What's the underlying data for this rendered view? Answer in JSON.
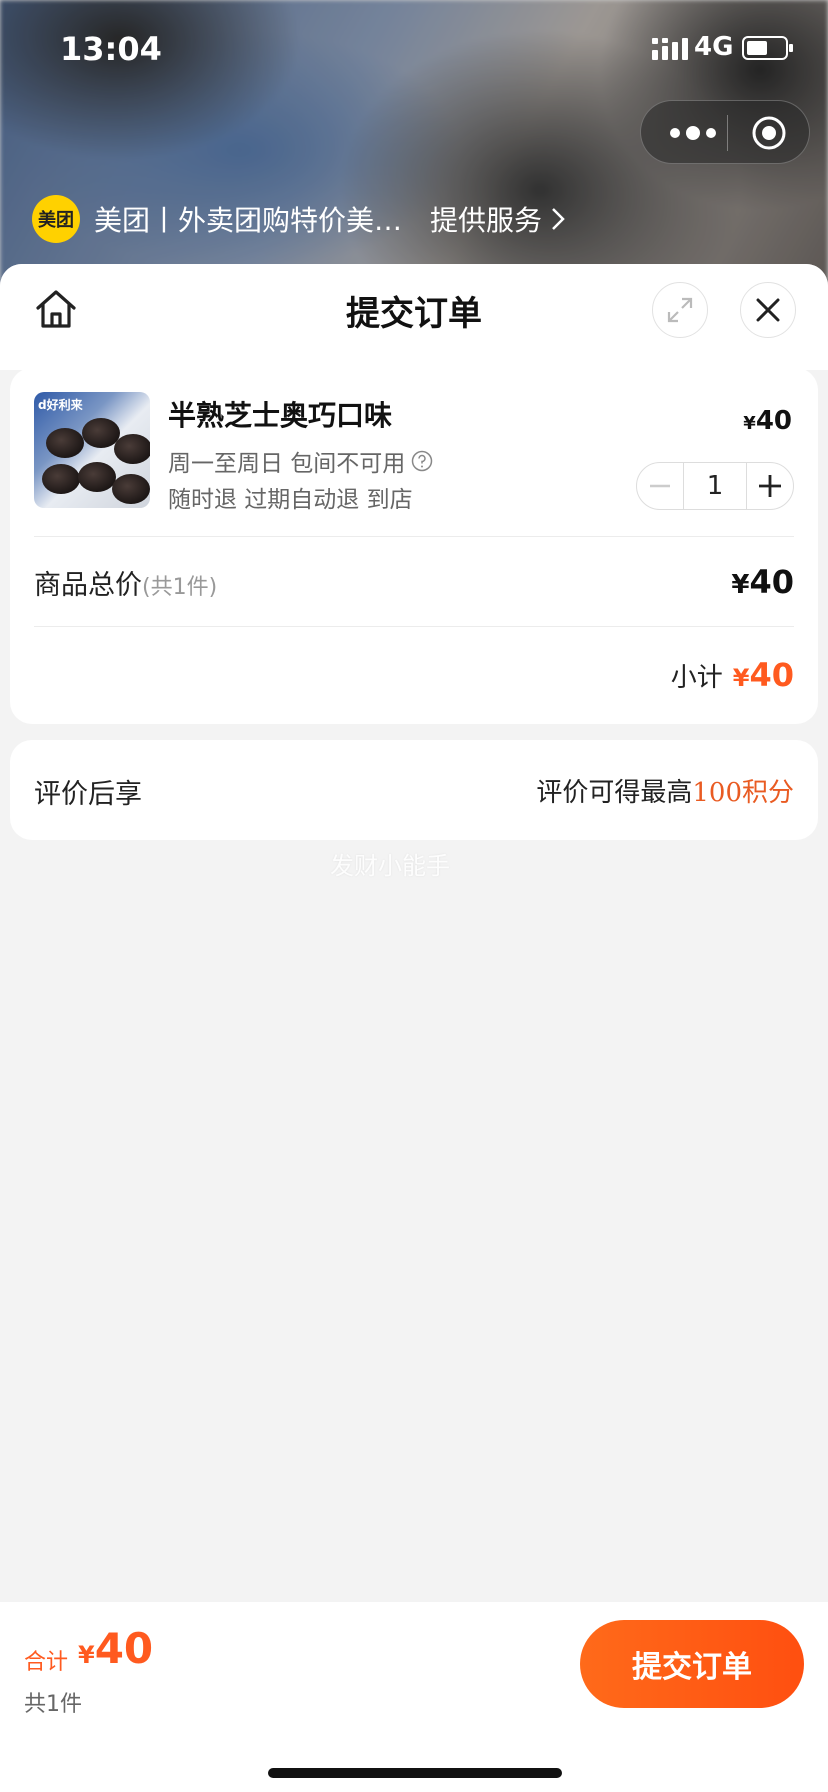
{
  "status_bar": {
    "time": "13:04",
    "network": "4G",
    "battery_level": 0.55
  },
  "service": {
    "logo_text": "美团",
    "name": "美团丨外卖团购特价美…",
    "provide_label": "提供服务"
  },
  "header": {
    "title": "提交订单"
  },
  "product": {
    "name": "半熟芝士奥巧口味",
    "price_symbol": "¥",
    "price": "40",
    "meta1": "周一至周日 包间不可用",
    "meta2": "随时退 过期自动退 到店",
    "thumb_brand": "d好利来",
    "quantity": "1"
  },
  "totals": {
    "label": "商品总价",
    "count": "(共1件)",
    "symbol": "¥",
    "value": "40",
    "subtotal_label": "小计",
    "subtotal_symbol": "¥",
    "subtotal_value": "40"
  },
  "review": {
    "label": "评价后享",
    "desc": "评价可得最高",
    "points": "100积分"
  },
  "watermark": "发财小能手",
  "footer": {
    "sum_label": "合计",
    "sum_symbol": "¥",
    "sum_value": "40",
    "count_label": "共1件",
    "submit_label": "提交订单"
  },
  "colors": {
    "accent": "#ff5a1f",
    "logo_yellow": "#ffd100",
    "points": "#e95b22"
  }
}
